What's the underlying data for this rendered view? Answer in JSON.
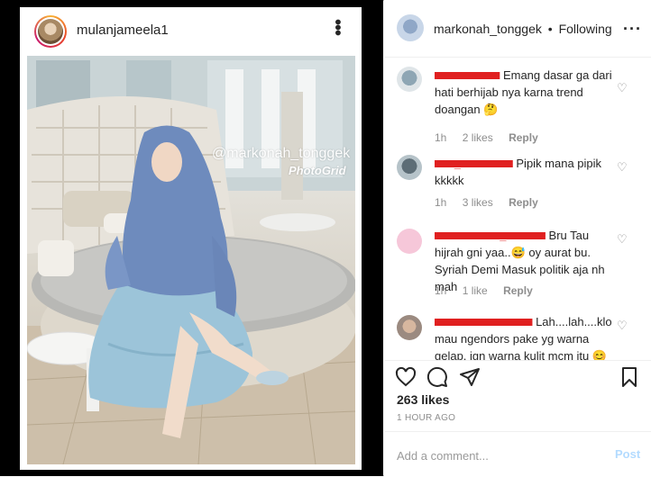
{
  "post": {
    "author": "mulanjameela1",
    "watermark_handle": "@markonah_tonggek",
    "watermark_app": "PhotoGrid"
  },
  "panel": {
    "username": "markonah_tonggek",
    "separator": "•",
    "follow_state": "Following"
  },
  "comments": [
    {
      "user": "xxxxxxxxxx",
      "text": "Emang dasar ga dari hati berhijab nya karna trend doangan 🤔",
      "age": "1h",
      "likes": "2 likes",
      "reply": "Reply"
    },
    {
      "user": "xxx_xxxxxxxx",
      "text": "Pipik mana pipik kkkkk",
      "age": "1h",
      "likes": "3 likes",
      "reply": "Reply"
    },
    {
      "user": "xxxxxxxxxx_xxxxxx",
      "text": "Bru Tau hijrah gni yaa..😅 oy aurat bu. Syriah Demi Masuk politik aja nh mah",
      "age": "1h",
      "likes": "1 like",
      "reply": "Reply"
    },
    {
      "user": "xxxxxxxxxxxxxxx",
      "text": "Lah....lah....klo mau ngendors pake yg warna gelap, jgn warna kulit mcm itu 😊",
      "age": "",
      "likes": "",
      "reply": ""
    }
  ],
  "likes_count": "263 likes",
  "time_ago": "1 HOUR AGO",
  "add_comment": {
    "placeholder": "Add a comment...",
    "post_label": "Post"
  },
  "icons": {
    "like": "heart-icon",
    "comment": "comment-icon",
    "share": "share-icon",
    "save": "bookmark-icon",
    "more": "more-icon"
  }
}
